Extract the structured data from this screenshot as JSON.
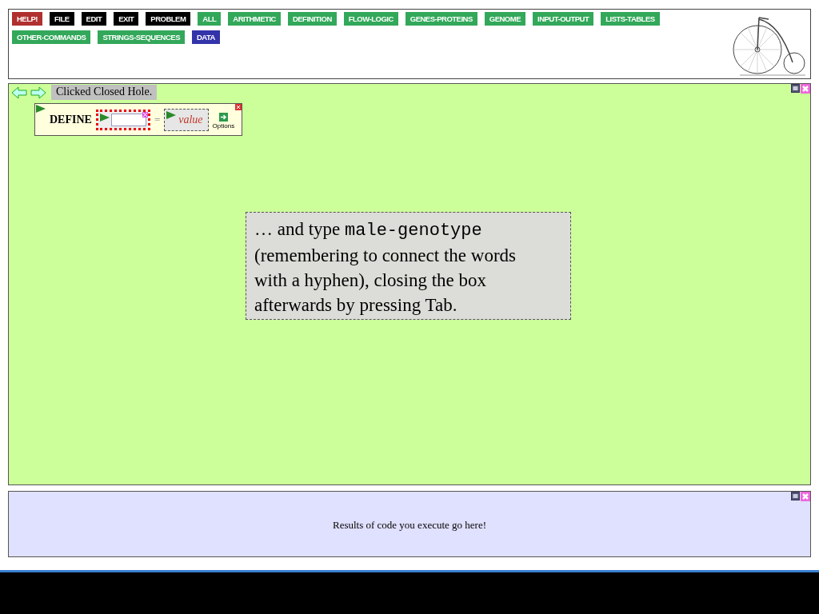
{
  "menu": [
    {
      "label": "HELP!",
      "color": "#b03030"
    },
    {
      "label": "FILE",
      "color": "#000000"
    },
    {
      "label": "EDIT",
      "color": "#000000"
    },
    {
      "label": "EXIT",
      "color": "#000000"
    },
    {
      "label": "PROBLEM",
      "color": "#000000"
    },
    {
      "label": "ALL",
      "color": "#33a85a"
    },
    {
      "label": "ARITHMETIC",
      "color": "#33a85a"
    },
    {
      "label": "DEFINITION",
      "color": "#33a85a"
    },
    {
      "label": "FLOW-LOGIC",
      "color": "#33a85a"
    },
    {
      "label": "GENES-PROTEINS",
      "color": "#33a85a"
    },
    {
      "label": "GENOME",
      "color": "#33a85a"
    },
    {
      "label": "INPUT-OUTPUT",
      "color": "#33a85a"
    },
    {
      "label": "LISTS-TABLES",
      "color": "#33a85a"
    },
    {
      "label": "OTHER-COMMANDS",
      "color": "#33a85a"
    },
    {
      "label": "STRINGS-SEQUENCES",
      "color": "#33a85a"
    },
    {
      "label": "DATA",
      "color": "#3333aa"
    }
  ],
  "workspace": {
    "status": "Clicked Closed Hole.",
    "define_block": {
      "keyword": "DEFINE",
      "equals": "=",
      "value_hole": "value",
      "options": "Options"
    },
    "tooltip": {
      "before": "… and type",
      "code": "male-genotype",
      "after": "(remembering to connect the words with a hyphen), closing the box afterwards by pressing Tab."
    }
  },
  "results": {
    "text": "Results of code you execute go here!"
  }
}
